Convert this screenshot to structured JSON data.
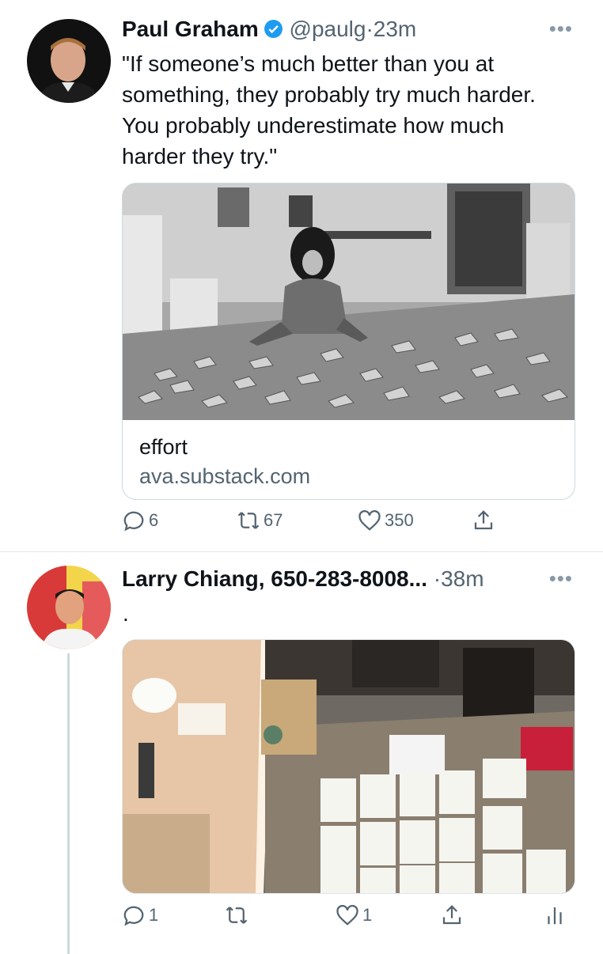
{
  "tweets": [
    {
      "author_name": "Paul Graham",
      "verified": true,
      "handle": "@paulg",
      "separator": "·",
      "time": "23m",
      "more": "•••",
      "text": "\"If someone’s much better than you at something, they probably try much harder. You probably underestimate how much harder they try.\"",
      "card": {
        "title": "effort",
        "domain": "ava.substack.com"
      },
      "actions": {
        "reply_count": "6",
        "retweet_count": "67",
        "like_count": "350"
      }
    },
    {
      "author_name": "Larry Chiang, 650-283-8008...",
      "separator": "·",
      "time": "38m",
      "more": "•••",
      "text": ".",
      "actions": {
        "reply_count": "1",
        "retweet_count": "",
        "like_count": "1"
      }
    }
  ],
  "colors": {
    "accent": "#1d9bf0",
    "secondary_text": "#536471",
    "border": "#cfd9de"
  },
  "icons": [
    "verified-badge-icon",
    "more-icon",
    "reply-icon",
    "retweet-icon",
    "like-icon",
    "share-icon",
    "analytics-icon"
  ]
}
